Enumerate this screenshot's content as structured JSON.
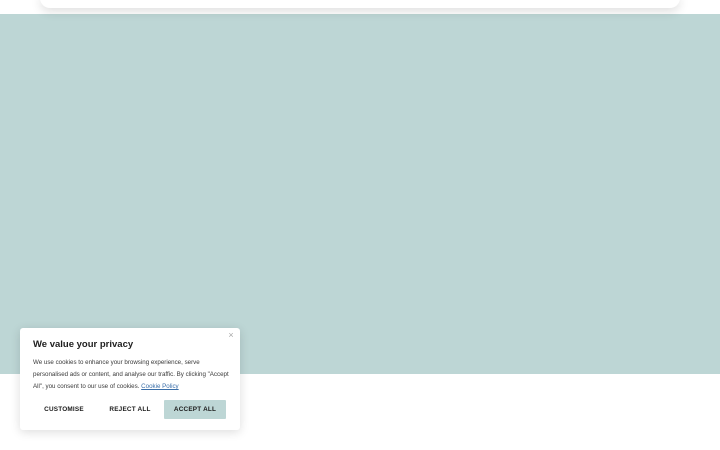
{
  "cookie_banner": {
    "close_label": "×",
    "title": "We value your privacy",
    "text": "We use cookies to enhance your browsing experience, serve personalised ads or content, and analyse our traffic. By clicking \"Accept All\", you consent to our use of cookies.",
    "policy_link": "Cookie Policy",
    "buttons": {
      "customise": "CUSTOMISE",
      "reject": "REJECT ALL",
      "accept": "ACCEPT ALL"
    }
  },
  "colors": {
    "hero_background": "#bdd6d5",
    "accept_button": "#bdd6d5",
    "link": "#3a6ea8"
  }
}
